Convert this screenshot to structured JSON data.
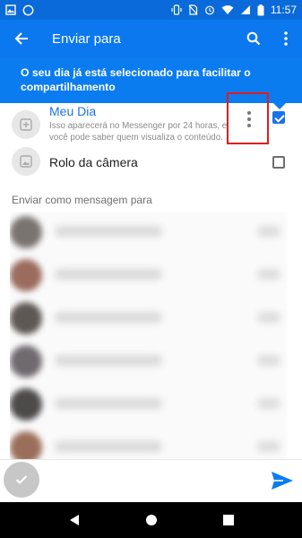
{
  "status_bar": {
    "time": "11:57",
    "left_icons": [
      "image-icon",
      "whatsapp-icon"
    ],
    "right_icons": [
      "vibrate-icon",
      "no-sim-icon",
      "alarm-icon",
      "wifi-icon",
      "signal-icon",
      "battery-icon"
    ]
  },
  "app_bar": {
    "title": "Enviar para",
    "back_icon": "arrow-left-icon",
    "search_icon": "search-icon",
    "menu_icon": "more-vertical-icon"
  },
  "tooltip": {
    "text": "O seu dia já está selecionado para facilitar o compartilhamento"
  },
  "my_day": {
    "title": "Meu Dia",
    "description": "Isso aparecerá no Messenger por 24 horas, e você pode saber quem visualiza o conteúdo.",
    "checked": true
  },
  "camera_roll": {
    "title": "Rolo da câmera",
    "checked": false
  },
  "section": {
    "label": "Enviar como mensagem para"
  },
  "colors": {
    "status_bar": "#0a6ad9",
    "app_bar": "#0b78ef",
    "accent": "#0b7cf0",
    "highlight": "#e21b1b",
    "title_blue": "#1a73e8"
  }
}
